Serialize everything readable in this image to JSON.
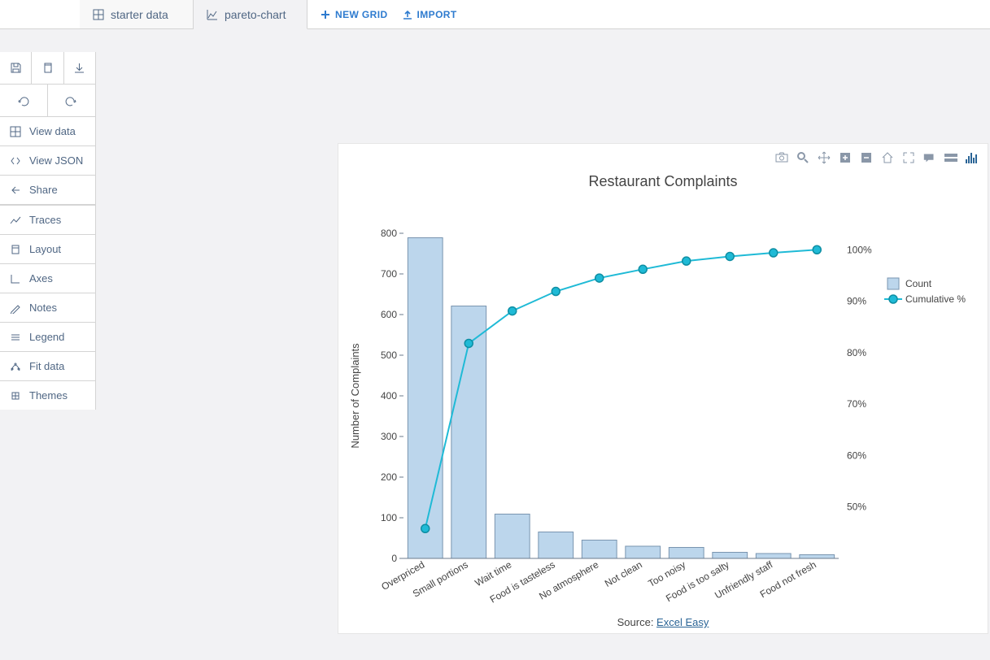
{
  "topbar": {
    "tabs": [
      {
        "label": "starter data",
        "icon": "grid-icon",
        "active": false
      },
      {
        "label": "pareto-chart",
        "icon": "line-chart-icon",
        "active": true
      }
    ],
    "actions": [
      {
        "label": "NEW GRID",
        "icon": "plus-icon"
      },
      {
        "label": "IMPORT",
        "icon": "upload-icon"
      }
    ]
  },
  "sidebar": {
    "quick_icons": [
      "save-icon",
      "copy-icon",
      "download-icon"
    ],
    "history_icons": [
      "undo-icon",
      "redo-icon"
    ],
    "items": [
      {
        "icon": "grid-icon",
        "label": "View data",
        "sep": false
      },
      {
        "icon": "code-icon",
        "label": "View JSON",
        "sep": false
      },
      {
        "icon": "share-icon",
        "label": "Share",
        "sep": true
      },
      {
        "icon": "traces-icon",
        "label": "Traces",
        "sep": false
      },
      {
        "icon": "layout-icon",
        "label": "Layout",
        "sep": false
      },
      {
        "icon": "axes-icon",
        "label": "Axes",
        "sep": false
      },
      {
        "icon": "notes-icon",
        "label": "Notes",
        "sep": false
      },
      {
        "icon": "legend-icon",
        "label": "Legend",
        "sep": false
      },
      {
        "icon": "fit-icon",
        "label": "Fit data",
        "sep": false
      },
      {
        "icon": "themes-icon",
        "label": "Themes",
        "sep": false
      }
    ]
  },
  "chart": {
    "title": "Restaurant Complaints",
    "modebar_icons": [
      "camera-icon",
      "zoom-icon",
      "pan-icon",
      "zoom-in-icon",
      "zoom-out-icon",
      "home-icon",
      "expand-icon",
      "tooltip-icon",
      "tooltip-compare-icon",
      "plotly-logo-icon"
    ],
    "source_prefix": "Source: ",
    "source_link_text": "Excel Easy"
  },
  "legend": {
    "items": [
      {
        "label": "Count",
        "type": "bar"
      },
      {
        "label": "Cumulative %",
        "type": "line"
      }
    ]
  },
  "chart_data": {
    "type": "pareto",
    "title": "Restaurant Complaints",
    "categories": [
      "Overpriced",
      "Small portions",
      "Wait time",
      "Food is tasteless",
      "No atmosphere",
      "Not clean",
      "Too noisy",
      "Food is too salty",
      "Unfriendly staff",
      "Food not fresh"
    ],
    "series": [
      {
        "name": "Count",
        "type": "bar",
        "values": [
          789,
          621,
          109,
          65,
          45,
          30,
          27,
          15,
          12,
          9
        ]
      },
      {
        "name": "Cumulative %",
        "type": "line",
        "values": [
          45.8,
          81.8,
          88.1,
          91.9,
          94.5,
          96.2,
          97.8,
          98.7,
          99.4,
          100.0
        ]
      }
    ],
    "ylabel": "Number of Complaints",
    "y_left_ticks": [
      0,
      100,
      200,
      300,
      400,
      500,
      600,
      700,
      800
    ],
    "y_right_ticks": [
      50,
      60,
      70,
      80,
      90,
      100
    ],
    "y_right_tick_labels": [
      "50%",
      "60%",
      "70%",
      "80%",
      "90%",
      "100%"
    ],
    "y_left_range": [
      0,
      800
    ],
    "y_right_range": [
      40,
      103.2
    ]
  }
}
